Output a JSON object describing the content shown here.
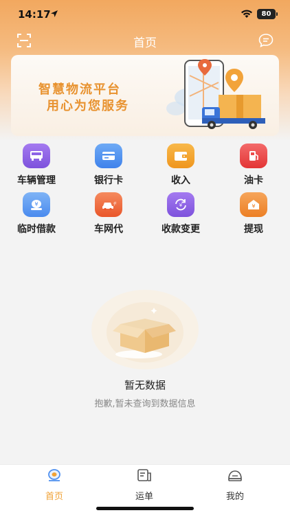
{
  "status_bar": {
    "time": "14:17",
    "battery": "80"
  },
  "nav": {
    "title": "首页"
  },
  "banner": {
    "line1": "智慧物流平台",
    "line2": "用心为您服务"
  },
  "features": [
    {
      "label": "车辆管理",
      "icon": "truck-icon",
      "color": "#8d63e6"
    },
    {
      "label": "银行卡",
      "icon": "bank-card-icon",
      "color": "#4f90ef"
    },
    {
      "label": "收入",
      "icon": "wallet-icon",
      "color": "#f3a12c"
    },
    {
      "label": "油卡",
      "icon": "fuel-icon",
      "color": "#ee4b4b"
    },
    {
      "label": "临时借款",
      "icon": "loan-icon",
      "color": "#5b9cf0"
    },
    {
      "label": "车网代",
      "icon": "car-agent-icon",
      "color": "#f06a3f"
    },
    {
      "label": "收款变更",
      "icon": "payee-change-icon",
      "color": "#8d63e6"
    },
    {
      "label": "提现",
      "icon": "withdraw-icon",
      "color": "#f08b35"
    }
  ],
  "empty_state": {
    "title": "暂无数据",
    "subtitle": "抱歉,暂未查询到数据信息"
  },
  "tabs": [
    {
      "label": "首页",
      "icon": "home-icon",
      "active": true
    },
    {
      "label": "运单",
      "icon": "waybill-icon",
      "active": false
    },
    {
      "label": "我的",
      "icon": "profile-icon",
      "active": false
    }
  ],
  "colors": {
    "accent": "#f0a236",
    "header": "#f2a85f",
    "inactive_tab": "#333333"
  }
}
